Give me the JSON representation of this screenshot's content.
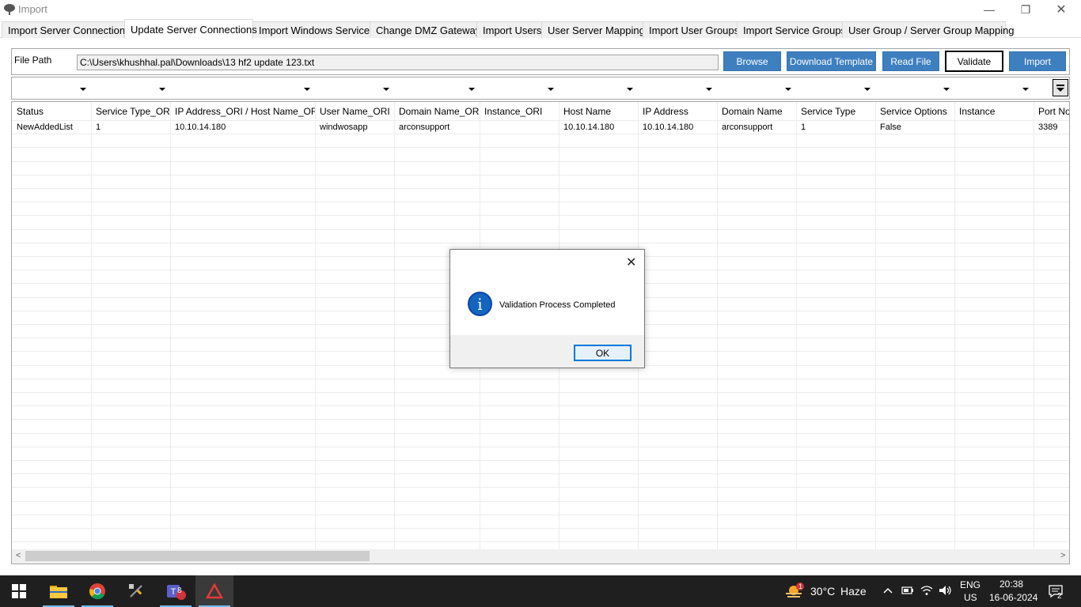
{
  "window": {
    "title": "Import",
    "minimize_glyph": "—",
    "restore_glyph": "❐",
    "close_glyph": "✕"
  },
  "tabs": [
    {
      "label": "Import Server Connections",
      "active": false
    },
    {
      "label": "Update Server Connections",
      "active": true
    },
    {
      "label": "Import Windows Services",
      "active": false
    },
    {
      "label": "Change DMZ Gateway",
      "active": false
    },
    {
      "label": "Import Users",
      "active": false
    },
    {
      "label": "User Server Mapping",
      "active": false
    },
    {
      "label": "Import User Groups",
      "active": false
    },
    {
      "label": "Import Service Groups",
      "active": false
    },
    {
      "label": "User Group / Server Group Mapping",
      "active": false
    }
  ],
  "file": {
    "label": "File Path",
    "value": "C:\\Users\\khushhal.pal\\Downloads\\13 hf2 update 123.txt"
  },
  "buttons": {
    "browse": "Browse",
    "download_template": "Download Template",
    "read_file": "Read File",
    "validate": "Validate",
    "import": "Import"
  },
  "grid": {
    "columns": [
      "Status",
      "Service Type_ORI",
      "IP Address_ORI / Host Name_ORI",
      "User Name_ORI",
      "Domain Name_ORI",
      "Instance_ORI",
      "Host Name",
      "IP Address",
      "Domain Name",
      "Service Type",
      "Service Options",
      "Instance",
      "Port No"
    ],
    "rows": [
      [
        "NewAddedList",
        "1",
        "10.10.14.180",
        "windwosapp",
        "arconsupport",
        "",
        "10.10.14.180",
        "10.10.14.180",
        "arconsupport",
        "1",
        "False",
        "",
        "3389"
      ]
    ]
  },
  "scroll": {
    "left_arrow": "<",
    "right_arrow": ">"
  },
  "dialog": {
    "message": "Validation Process Completed",
    "ok": "OK",
    "close_glyph": "✕",
    "info_glyph": "i"
  },
  "taskbar": {
    "teams_badge": "8",
    "weather_badge": "1",
    "temperature": "30°C",
    "condition": "Haze",
    "lang_top": "ENG",
    "lang_bottom": "US",
    "time": "20:38",
    "date": "16-06-2024",
    "notification_count": "2"
  },
  "colors": {
    "button_blue": "#3e7fbf",
    "info_blue": "#1565c0",
    "taskbar": "#1f1f1f"
  }
}
